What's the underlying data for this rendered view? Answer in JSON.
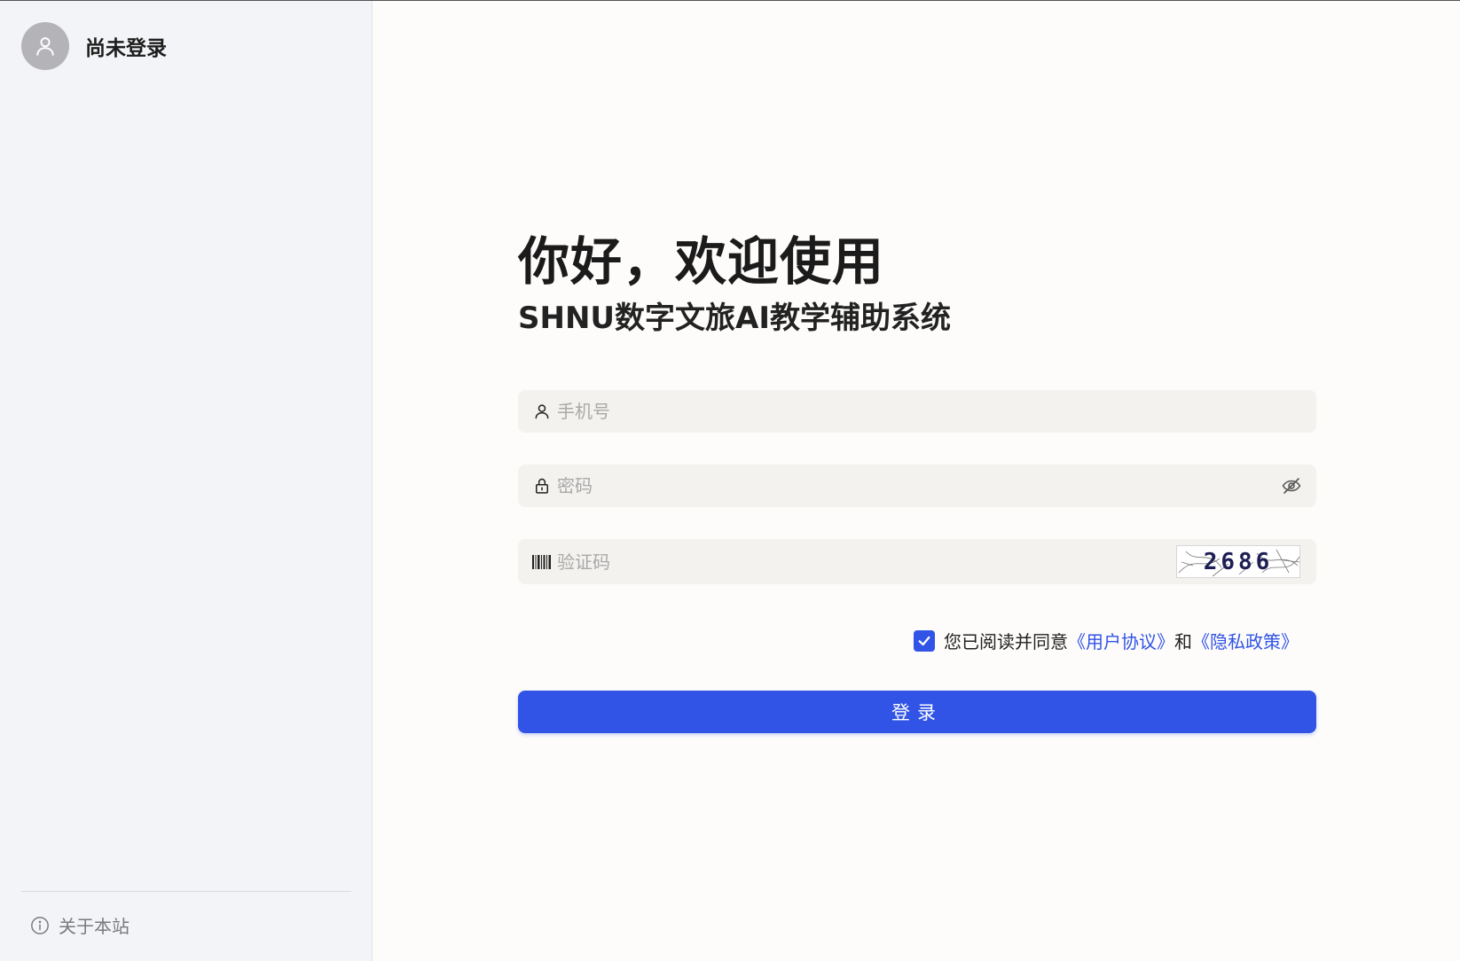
{
  "sidebar": {
    "user": {
      "name": "尚未登录",
      "avatar_icon": "user-icon"
    },
    "about": {
      "label": "关于本站",
      "icon": "info-icon"
    }
  },
  "login": {
    "greeting": "你好，欢迎使用",
    "system_name": "SHNU数字文旅AI教学辅助系统",
    "phone": {
      "placeholder": "手机号",
      "value": "",
      "icon": "user-icon"
    },
    "password": {
      "placeholder": "密码",
      "value": "",
      "icon": "lock-icon",
      "toggle_icon": "eye-off-icon"
    },
    "captcha": {
      "placeholder": "验证码",
      "value": "",
      "icon": "barcode-icon",
      "image_code": "2686"
    },
    "agreement": {
      "checked": true,
      "prefix": "您已阅读并同意",
      "user_agreement": "《用户协议》",
      "conjunction": "和",
      "privacy_policy": "《隐私政策》"
    },
    "submit_label": "登录"
  },
  "colors": {
    "accent": "#3153e6",
    "sidebar_bg": "#f3f4f7",
    "field_bg": "#f4f2ef"
  }
}
